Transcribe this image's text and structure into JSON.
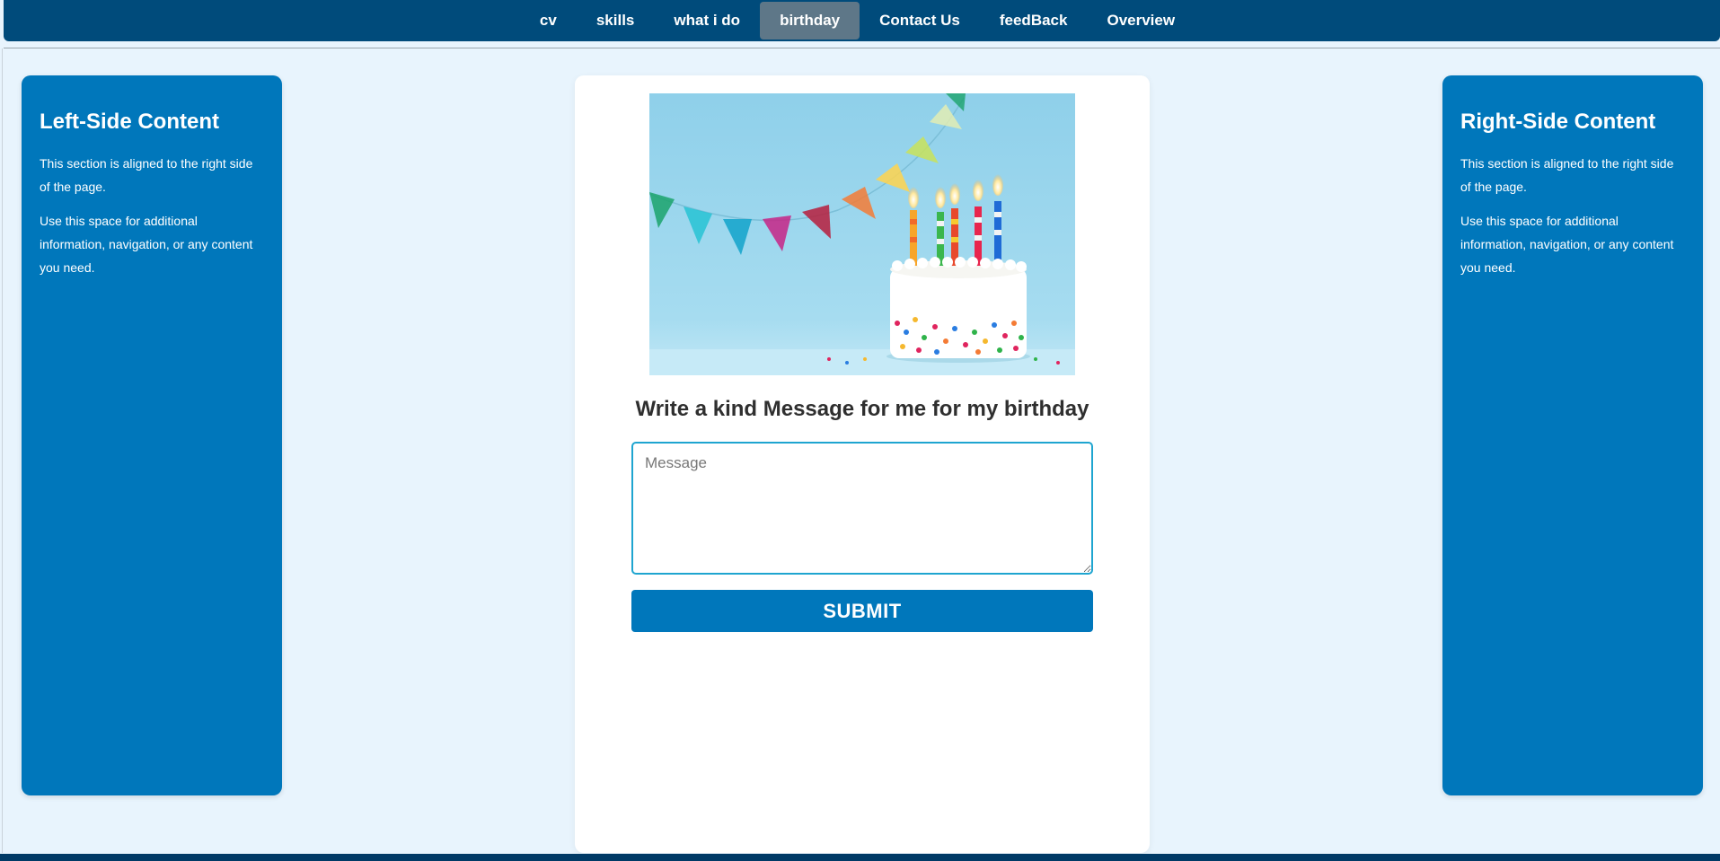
{
  "nav": {
    "items": [
      {
        "label": "cv",
        "active": false
      },
      {
        "label": "skills",
        "active": false
      },
      {
        "label": "what i do",
        "active": false
      },
      {
        "label": "birthday",
        "active": true
      },
      {
        "label": "Contact Us",
        "active": false
      },
      {
        "label": "feedBack",
        "active": false
      },
      {
        "label": "Overview",
        "active": false
      }
    ]
  },
  "left_panel": {
    "title": "Left-Side Content",
    "para1": "This section is aligned to the right side of the page.",
    "para2": "Use this space for additional information, navigation, or any content you need."
  },
  "right_panel": {
    "title": "Right-Side Content",
    "para1": "This section is aligned to the right side of the page.",
    "para2": "Use this space for additional information, navigation, or any content you need."
  },
  "main": {
    "image_alt": "birthday cake with candles",
    "prompt": "Write a kind Message for me for my birthday",
    "message_placeholder": "Message",
    "message_value": "",
    "submit_label": "SUBMIT"
  },
  "colors": {
    "nav_bg": "#004b7b",
    "nav_active": "#5e7788",
    "panel_bg": "#0077bb",
    "page_bg": "#e8f4fd",
    "input_border": "#1fa5d0"
  }
}
